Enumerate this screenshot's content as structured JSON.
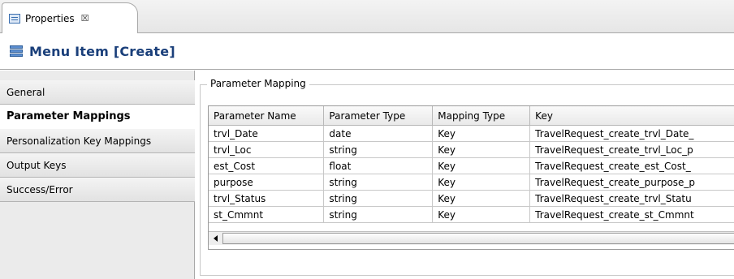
{
  "tab": {
    "label": "Properties",
    "close_glyph": "☒",
    "icon": "properties-icon"
  },
  "title": {
    "text": "Menu Item [Create]",
    "icon": "menu-item-icon"
  },
  "nav": {
    "items": [
      {
        "label": "General"
      },
      {
        "label": "Parameter Mappings"
      },
      {
        "label": "Personalization Key Mappings"
      },
      {
        "label": "Output Keys"
      },
      {
        "label": "Success/Error"
      }
    ],
    "active_index": 1
  },
  "group": {
    "label": "Parameter Mapping"
  },
  "table": {
    "columns": [
      "Parameter Name",
      "Parameter Type",
      "Mapping Type",
      "Key"
    ],
    "rows": [
      [
        "trvl_Date",
        "date",
        "Key",
        "TravelRequest_create_trvl_Date_"
      ],
      [
        "trvl_Loc",
        "string",
        "Key",
        "TravelRequest_create_trvl_Loc_p"
      ],
      [
        "est_Cost",
        "float",
        "Key",
        "TravelRequest_create_est_Cost_"
      ],
      [
        "purpose",
        "string",
        "Key",
        "TravelRequest_create_purpose_p"
      ],
      [
        "trvl_Status",
        "string",
        "Key",
        "TravelRequest_create_trvl_Statu"
      ],
      [
        "st_Cmmnt",
        "string",
        "Key",
        "TravelRequest_create_st_Cmmnt"
      ]
    ]
  },
  "colors": {
    "title": "#1a3f7a",
    "nav_bg": "#ebebeb",
    "border": "#a8a8a8"
  }
}
